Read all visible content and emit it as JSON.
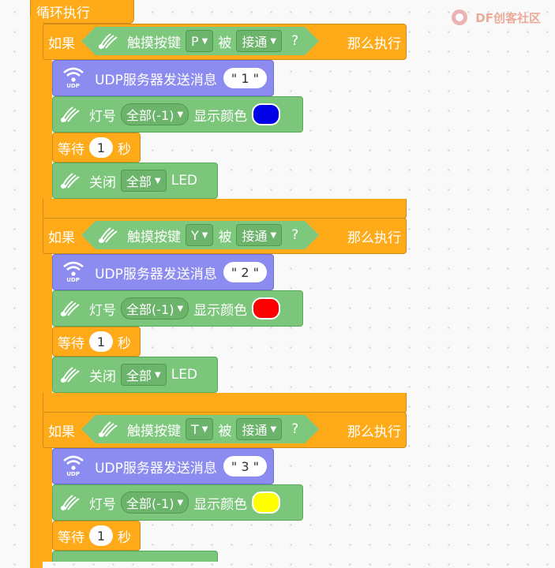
{
  "top_label": "循环执行",
  "watermark": "DF创客社区",
  "colors": {
    "loop": "#ffab19",
    "touch": "#7bc67b",
    "udp": "#8c8cf0"
  },
  "if_label": "如果",
  "then_label": "那么执行",
  "touch_label": "触摸按键",
  "is_label": "被",
  "question": "?",
  "led_label": "灯号",
  "show_color_label": "显示颜色",
  "wait_label": "等待",
  "seconds_label": "秒",
  "close_label": "关闭",
  "led_suffix": "LED",
  "udp_label": "UDP服务器发送消息",
  "udp_icon_text": "UDP",
  "blocks": [
    {
      "key": "P",
      "state": "接通",
      "msg": "1",
      "led": "全部(-1)",
      "color_name": "blue",
      "color": "#0000e6",
      "wait": "1",
      "close": "全部"
    },
    {
      "key": "Y",
      "state": "接通",
      "msg": "2",
      "led": "全部(-1)",
      "color_name": "red",
      "color": "#ff0000",
      "wait": "1",
      "close": "全部"
    },
    {
      "key": "T",
      "state": "接通",
      "msg": "3",
      "led": "全部(-1)",
      "color_name": "yellow",
      "color": "#ffff00",
      "wait": "1",
      "close": ""
    }
  ]
}
